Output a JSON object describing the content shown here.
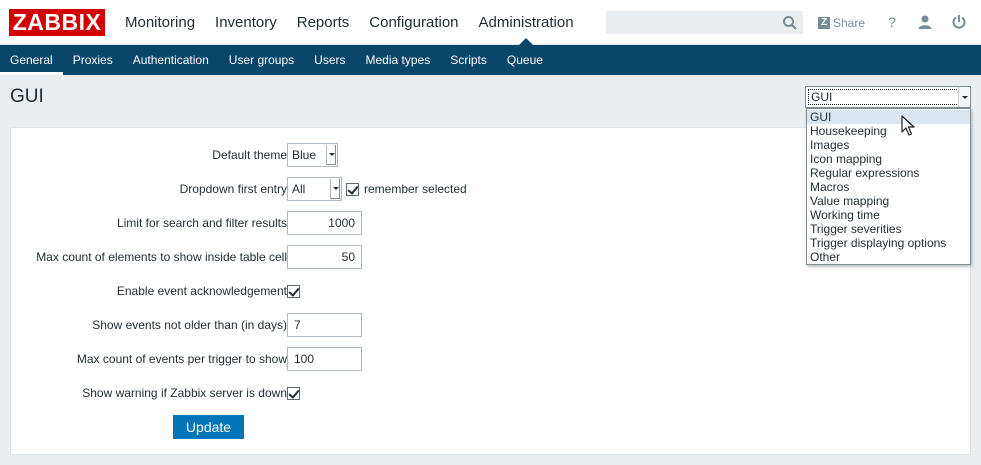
{
  "header": {
    "logo": "ZABBIX",
    "nav": [
      {
        "label": "Monitoring"
      },
      {
        "label": "Inventory"
      },
      {
        "label": "Reports"
      },
      {
        "label": "Configuration"
      },
      {
        "label": "Administration",
        "selected": true
      }
    ],
    "search": {
      "value": "",
      "placeholder": ""
    },
    "share_label": "Share",
    "help_label": "?",
    "icons": [
      "search-icon",
      "share-icon",
      "help-icon",
      "user-icon",
      "power-icon"
    ]
  },
  "subnav": [
    {
      "label": "General",
      "selected": true
    },
    {
      "label": "Proxies"
    },
    {
      "label": "Authentication"
    },
    {
      "label": "User groups"
    },
    {
      "label": "Users"
    },
    {
      "label": "Media types"
    },
    {
      "label": "Scripts"
    },
    {
      "label": "Queue"
    }
  ],
  "page": {
    "title": "GUI",
    "select_value": "GUI",
    "select_options": [
      "GUI",
      "Housekeeping",
      "Images",
      "Icon mapping",
      "Regular expressions",
      "Macros",
      "Value mapping",
      "Working time",
      "Trigger severities",
      "Trigger displaying options",
      "Other"
    ],
    "highlighted_option": "GUI"
  },
  "form": {
    "default_theme": {
      "label": "Default theme",
      "value": "Blue"
    },
    "dropdown_first_entry": {
      "label": "Dropdown first entry",
      "value": "All",
      "remember_label": "remember selected",
      "remember_checked": true
    },
    "search_limit": {
      "label": "Limit for search and filter results",
      "value": "1000"
    },
    "max_in_table": {
      "label": "Max count of elements to show inside table cell",
      "value": "50"
    },
    "event_ack": {
      "label": "Enable event acknowledgement",
      "checked": true
    },
    "event_expire": {
      "label": "Show events not older than (in days)",
      "value": "7"
    },
    "event_show_max": {
      "label": "Max count of events per trigger to show",
      "value": "100"
    },
    "server_check": {
      "label": "Show warning if Zabbix server is down",
      "checked": true
    },
    "update_label": "Update"
  },
  "colors": {
    "logo_bg": "#d40000",
    "subnav_bg": "#0a466a",
    "button_bg": "#0275b8",
    "page_bg": "#ebeef0"
  }
}
